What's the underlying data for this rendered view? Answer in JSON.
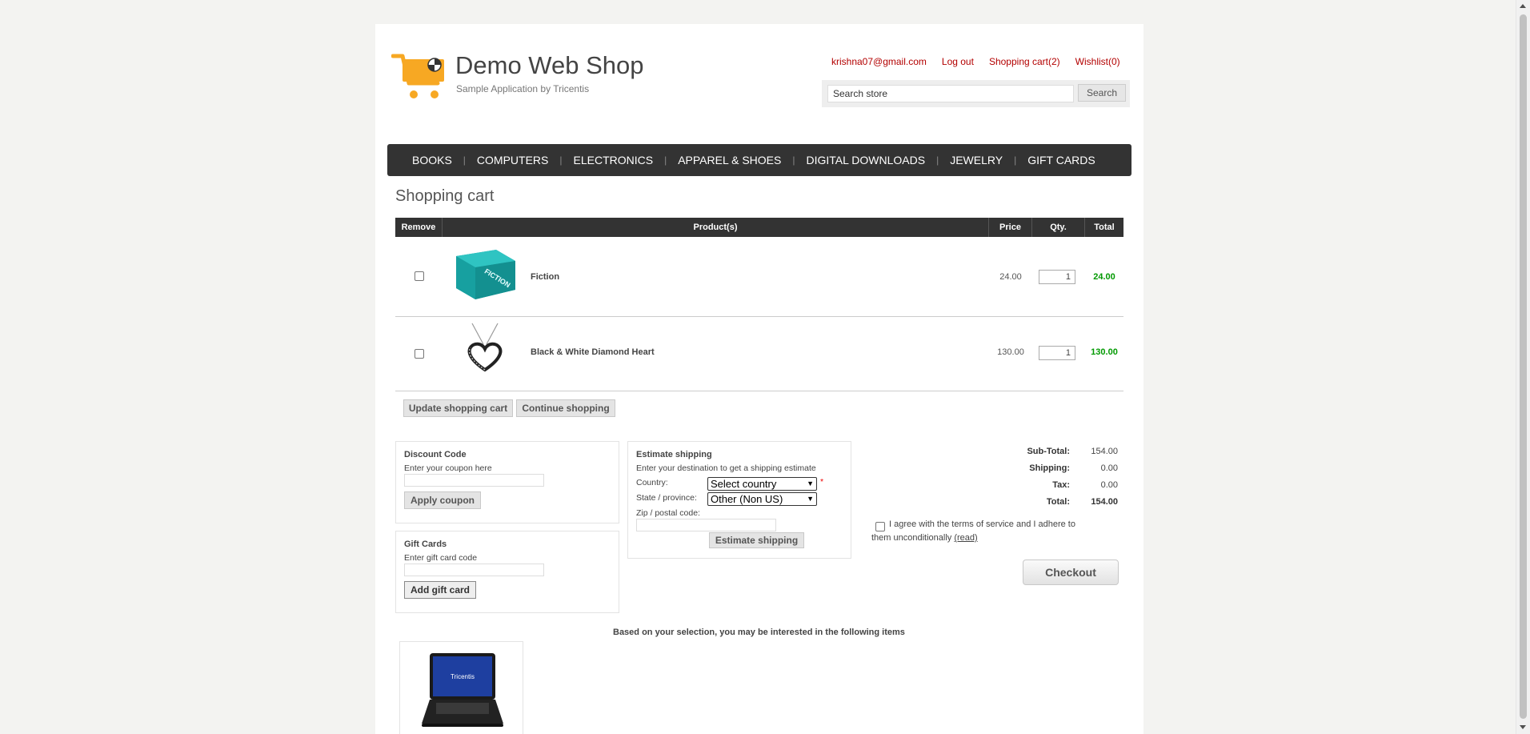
{
  "header": {
    "site_title": "Demo Web Shop",
    "site_subtitle": "Sample Application by Tricentis",
    "links": {
      "account": "krishna07@gmail.com",
      "logout": "Log out",
      "cart": "Shopping cart(2)",
      "wishlist": "Wishlist(0)"
    },
    "search": {
      "placeholder": "Search store",
      "button": "Search"
    }
  },
  "menu": [
    "BOOKS",
    "COMPUTERS",
    "ELECTRONICS",
    "APPAREL & SHOES",
    "DIGITAL DOWNLOADS",
    "JEWELRY",
    "GIFT CARDS"
  ],
  "page_title": "Shopping cart",
  "cart": {
    "columns": {
      "remove": "Remove",
      "products": "Product(s)",
      "price": "Price",
      "qty": "Qty.",
      "total": "Total"
    },
    "items": [
      {
        "name": "Fiction",
        "price": "24.00",
        "qty": "1",
        "total": "24.00",
        "image_text": "FICTION"
      },
      {
        "name": "Black & White Diamond Heart",
        "price": "130.00",
        "qty": "1",
        "total": "130.00"
      }
    ],
    "buttons": {
      "update": "Update shopping cart",
      "continue": "Continue shopping"
    }
  },
  "discount": {
    "title": "Discount Code",
    "hint": "Enter your coupon here",
    "button": "Apply coupon"
  },
  "giftcard": {
    "title": "Gift Cards",
    "hint": "Enter gift card code",
    "button": "Add gift card"
  },
  "shipping": {
    "title": "Estimate shipping",
    "hint": "Enter your destination to get a shipping estimate",
    "country_label": "Country:",
    "country_value": "Select country",
    "required_mark": "*",
    "state_label": "State / province:",
    "state_value": "Other (Non US)",
    "zip_label": "Zip / postal code:",
    "button": "Estimate shipping"
  },
  "totals": {
    "subtotal_label": "Sub-Total:",
    "subtotal": "154.00",
    "shipping_label": "Shipping:",
    "shipping": "0.00",
    "tax_label": "Tax:",
    "tax": "0.00",
    "total_label": "Total:",
    "total": "154.00"
  },
  "terms": {
    "text": "I agree with the terms of service and I adhere to them unconditionally",
    "read": "(read)"
  },
  "checkout": "Checkout",
  "crosssell": {
    "title": "Based on your selection, you may be interested in the following items",
    "laptop_brand": "Tricentis"
  },
  "colors": {
    "accent_link": "#b30000",
    "menu_bg": "#333333",
    "total_green": "#009900",
    "cart_orange": "#f7a823"
  }
}
